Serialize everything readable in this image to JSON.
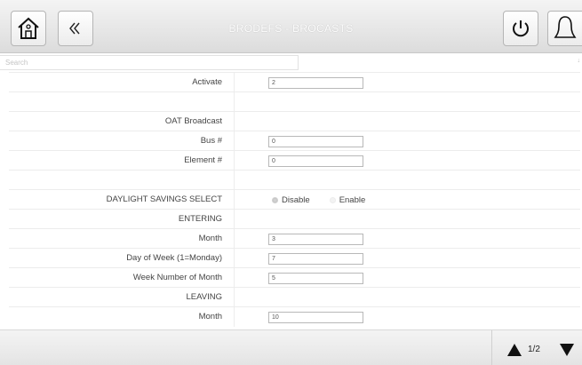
{
  "header": {
    "title": "BRODEFS - BROCASTS",
    "home_icon": "home-icon",
    "back_icon": "double-chevron-left-icon",
    "power_icon": "power-icon",
    "alarm_icon": "bell-icon"
  },
  "search": {
    "placeholder": "Search",
    "value": "",
    "scroll_indicator": "↓"
  },
  "rows": {
    "activate": {
      "label": "Activate",
      "value": "2"
    },
    "blank1": {
      "label": ""
    },
    "oat_broadcast": {
      "label": "OAT Broadcast"
    },
    "bus": {
      "label": "Bus #",
      "value": "0"
    },
    "element": {
      "label": "Element #",
      "value": "0"
    },
    "blank2": {
      "label": ""
    },
    "daylight": {
      "label": "DAYLIGHT SAVINGS SELECT",
      "options": [
        "Disable",
        "Enable"
      ],
      "selected": "Disable"
    },
    "entering": {
      "label": "ENTERING"
    },
    "entering_month": {
      "label": "Month",
      "value": "3"
    },
    "day_of_week": {
      "label": "Day of Week (1=Monday)",
      "value": "7"
    },
    "week_number": {
      "label": "Week Number of Month",
      "value": "5"
    },
    "leaving": {
      "label": "LEAVING"
    },
    "leaving_month": {
      "label": "Month",
      "value": "10"
    }
  },
  "footer": {
    "page_indicator": "1/2",
    "up_icon": "triangle-up-icon",
    "down_icon": "triangle-down-icon"
  },
  "colors": {
    "header_gradient_top": "#f4f4f4",
    "header_gradient_bottom": "#dcdcdc",
    "border": "#b5b5b5",
    "text": "#444444"
  }
}
